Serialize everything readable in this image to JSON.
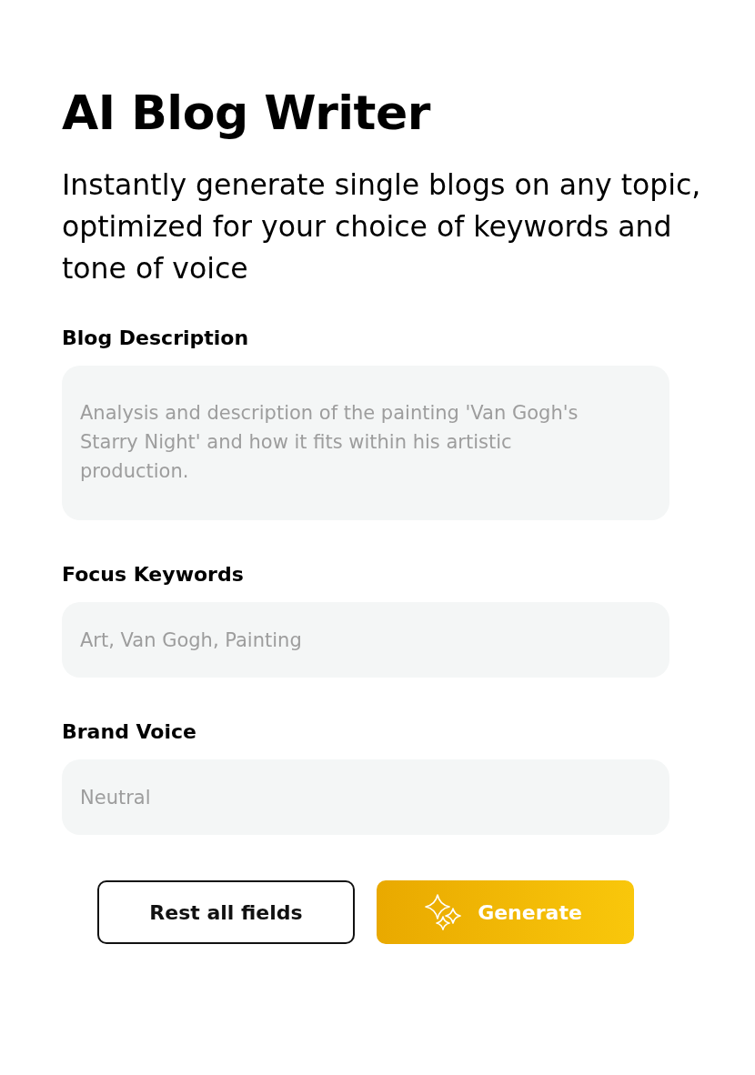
{
  "title": "AI Blog Writer",
  "subtitle": "Instantly generate single blogs on any topic, optimized for your choice of keywords and tone of voice",
  "fields": [
    {
      "kind": "textarea",
      "label": "Blog Description",
      "placeholder": "Analysis and description of the painting 'Van Gogh's Starry Night' and how it fits within his artistic production."
    },
    {
      "kind": "input",
      "label": "Focus Keywords",
      "placeholder": "Art, Van Gogh, Painting"
    },
    {
      "kind": "input",
      "label": "Brand Voice",
      "placeholder": "Neutral"
    }
  ],
  "buttons": [
    {
      "kind": "outline",
      "label": "Rest all fields"
    },
    {
      "kind": "primary",
      "label": "Generate"
    }
  ]
}
